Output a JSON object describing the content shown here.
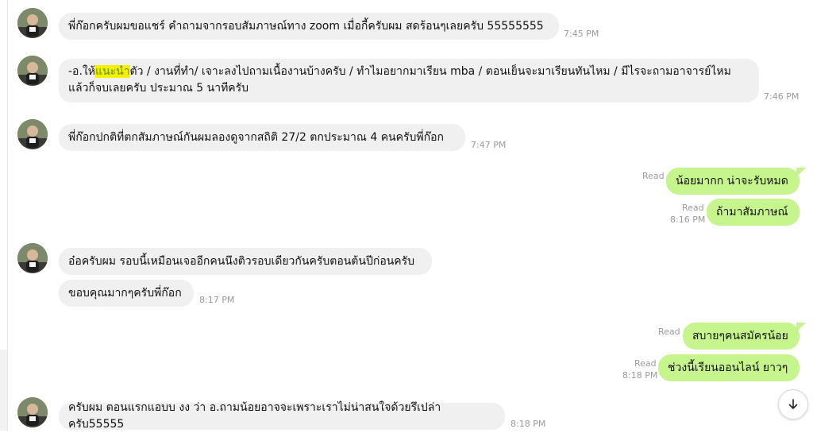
{
  "colors": {
    "incoming_bubble": "#f0f0f0",
    "outgoing_bubble": "#c6f48d",
    "highlight": "#f4f000",
    "meta_text": "#9a9a9a"
  },
  "messages": [
    {
      "text": "พี่ก๊อกครับผมขอแชร์ คำถามจากรอบสัมภาษณ์ทาง zoom เมื่อกี้ครับผม สดร้อนๆเลยครับ 55555555",
      "time": "7:45 PM"
    },
    {
      "pre": "-อ.ให้",
      "highlight": "แนะนำ",
      "post": "ตัว / งานที่ทำ/ เจาะลงไปถามเนื้องานบ้างครับ / ทำไมอยากมาเรียน mba / ตอนเย็นจะมาเรียนทันไหม / มีไรจะถามอาจารย์ไหม",
      "line2": "แล้วก็จบเลยครับ ประมาณ 5 นาทีครับ",
      "time": "7:46 PM"
    },
    {
      "text": "พี่ก๊อกปกติที่ตกสัมภาษณ์กันผมลองดูจากสถิติ 27/2 ตกประมาณ 4 คนครับพี่ก๊อก",
      "time": "7:47 PM"
    },
    {
      "text": "น้อยมากก น่าจะรับหมด",
      "read": "Read"
    },
    {
      "text": "ถ้ามาสัมภาษณ์",
      "read": "Read",
      "time": "8:16 PM"
    },
    {
      "text": "อ๋อครับผม รอบนี้เหมือนเจออีกคนนึงติวรอบเดียวกันครับตอนต้นปีก่อนครับ"
    },
    {
      "text": "ขอบคุณมากๆครับพี่ก๊อก",
      "time": "8:17 PM"
    },
    {
      "text": "สบายๆคนสมัครน้อย",
      "read": "Read"
    },
    {
      "text": "ช่วงนี้เรียนออนไลน์ ยาวๆ",
      "read": "Read",
      "time": "8:18 PM"
    },
    {
      "text": "ครับผม ตอนแรกแอบบ งง ว่า อ.ถามน้อยอาจจะเพราะเราไม่น่าสนใจด้วยรึเปล่าครับ55555",
      "time": "8:18 PM"
    }
  ],
  "icons": {
    "scroll_down": "arrow-down-icon",
    "avatar": "avatar"
  }
}
